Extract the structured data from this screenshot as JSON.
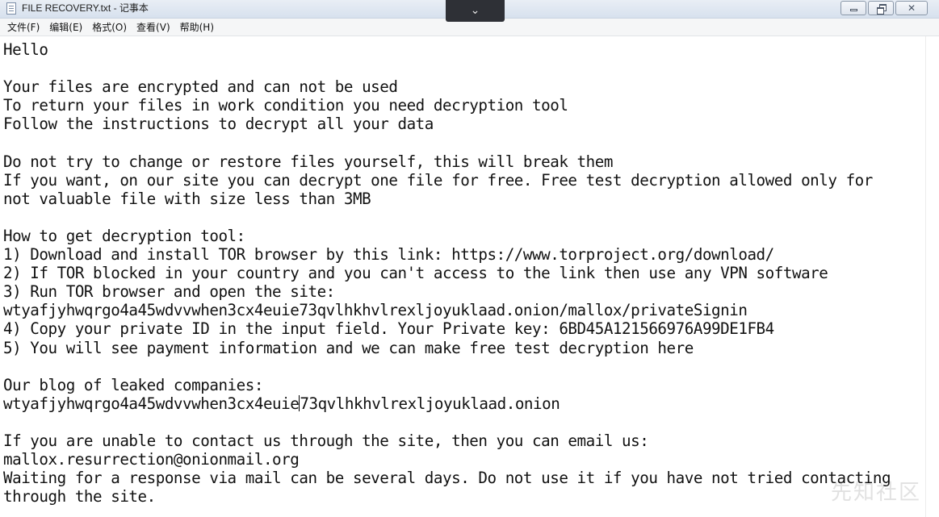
{
  "window": {
    "title": "FILE RECOVERY.txt - 记事本",
    "dropdown_glyph": "⌄",
    "icons": {
      "app": "notepad-icon",
      "minimize": "minimize-icon",
      "maximize": "restore-icon",
      "close": "close-icon"
    }
  },
  "menu": {
    "items": [
      {
        "label": "文件(F)"
      },
      {
        "label": "编辑(E)"
      },
      {
        "label": "格式(O)"
      },
      {
        "label": "查看(V)"
      },
      {
        "label": "帮助(H)"
      }
    ]
  },
  "document": {
    "lines": [
      "Hello",
      "",
      "Your files are encrypted and can not be used",
      "To return your files in work condition you need decryption tool",
      "Follow the instructions to decrypt all your data",
      "",
      "Do not try to change or restore files yourself, this will break them",
      "If you want, on our site you can decrypt one file for free. Free test decryption allowed only for",
      "not valuable file with size less than 3MB",
      "",
      "How to get decryption tool:",
      "1) Download and install TOR browser by this link: https://www.torproject.org/download/",
      "2) If TOR blocked in your country and you can't access to the link then use any VPN software",
      "3) Run TOR browser and open the site:",
      "wtyafjyhwqrgo4a45wdvvwhen3cx4euie73qvlhkhvlrexljoyuklaad.onion/mallox/privateSignin",
      "4) Copy your private ID in the input field. Your Private key: 6BD45A121566976A99DE1FB4",
      "5) You will see payment information and we can make free test decryption here",
      "",
      "Our blog of leaked companies:",
      "",
      "",
      "If you are unable to contact us through the site, then you can email us:",
      "mallox.resurrection@onionmail.org",
      "Waiting for a response via mail can be several days. Do not use it if you have not tried contacting",
      "through the site."
    ],
    "blog_line_before_caret": "wtyafjyhwqrgo4a45wdvvwhen3cx4euie",
    "blog_line_after_caret": "73qvlhkhvlrexljoyuklaad.onion"
  },
  "watermark": "先知社区"
}
